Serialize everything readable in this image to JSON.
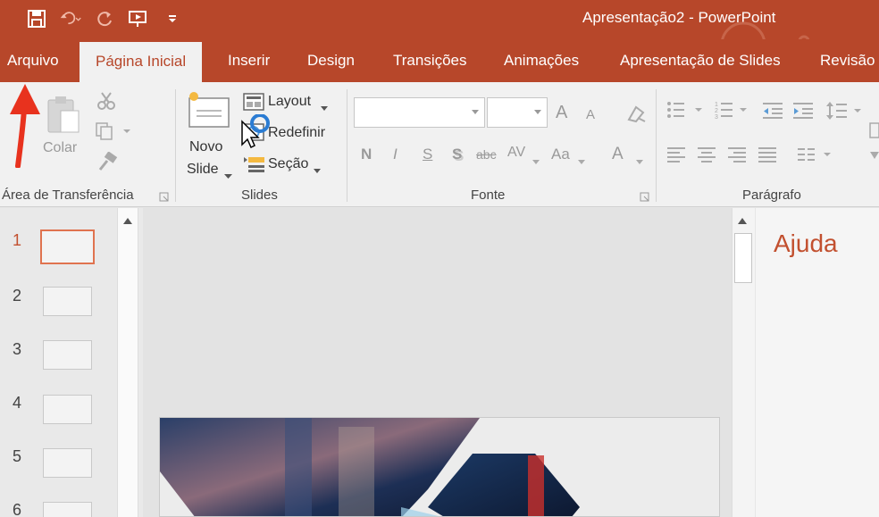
{
  "window": {
    "title": "Apresentação2 - PowerPoint"
  },
  "qat": {
    "icons": [
      "save-icon",
      "undo-icon",
      "redo-icon",
      "start-from-beginning-icon",
      "customize-qat-icon"
    ]
  },
  "tabs": [
    {
      "label": "Arquivo"
    },
    {
      "label": "Página Inicial"
    },
    {
      "label": "Inserir"
    },
    {
      "label": "Design"
    },
    {
      "label": "Transições"
    },
    {
      "label": "Animações"
    },
    {
      "label": "Apresentação de Slides"
    },
    {
      "label": "Revisão"
    }
  ],
  "ribbon": {
    "clipboard": {
      "group_label": "Área de Transferência",
      "paste_label": "Colar"
    },
    "slides": {
      "group_label": "Slides",
      "new_slide_line1": "Novo",
      "new_slide_line2": "Slide",
      "layout_label": "Layout",
      "reset_label": "Redefinir",
      "section_label": "Seção"
    },
    "font": {
      "group_label": "Fonte",
      "bold": "N",
      "italic": "I",
      "underline": "S",
      "shadow": "S",
      "strike": "abc",
      "spacing": "AV",
      "case": "Aa",
      "color": "A",
      "grow": "A",
      "shrink": "A"
    },
    "paragraph": {
      "group_label": "Parágrafo"
    }
  },
  "thumbnails": [
    "1",
    "2",
    "3",
    "4",
    "5",
    "6"
  ],
  "selected_slide": "1",
  "help_pane": {
    "title": "Ajuda"
  },
  "colors": {
    "accent": "#b7472a",
    "selected": "#e0734f",
    "arrow": "#e8321e"
  }
}
